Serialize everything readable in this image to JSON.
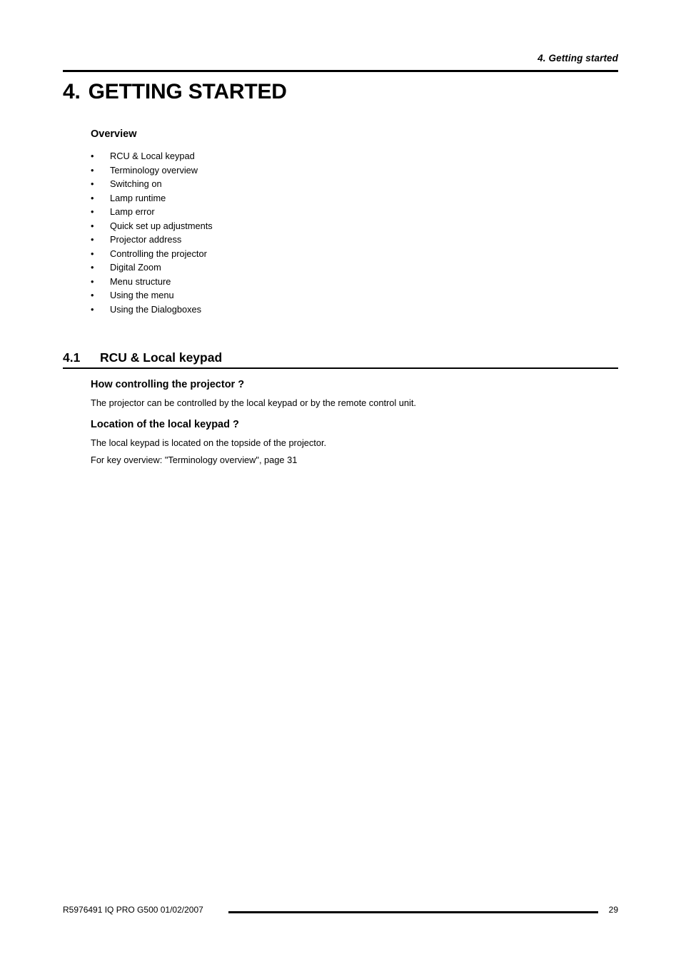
{
  "document": {
    "running_header": "4.  Getting started",
    "chapter": {
      "number": "4.",
      "title": "GETTING STARTED"
    },
    "overview": {
      "heading": "Overview",
      "bullet_glyph": "•",
      "items": [
        "RCU & Local keypad",
        "Terminology overview",
        "Switching on",
        "Lamp runtime",
        "Lamp error",
        "Quick set up adjustments",
        "Projector address",
        "Controlling the projector",
        "Digital Zoom",
        "Menu structure",
        "Using the menu",
        "Using the Dialogboxes"
      ]
    },
    "section": {
      "number": "4.1",
      "title": "RCU & Local keypad",
      "blocks": [
        {
          "heading": "How controlling the projector ?",
          "paragraph": "The projector can be controlled by the local keypad or by the remote control unit."
        },
        {
          "heading": "Location of the local keypad ?",
          "paragraph_1": "The local keypad is located on the topside of the projector.",
          "paragraph_2": "For key overview:  \"Terminology overview\", page 31"
        }
      ]
    },
    "footer": {
      "left": "R5976491  IQ PRO G500  01/02/2007",
      "page_number": "29"
    }
  }
}
